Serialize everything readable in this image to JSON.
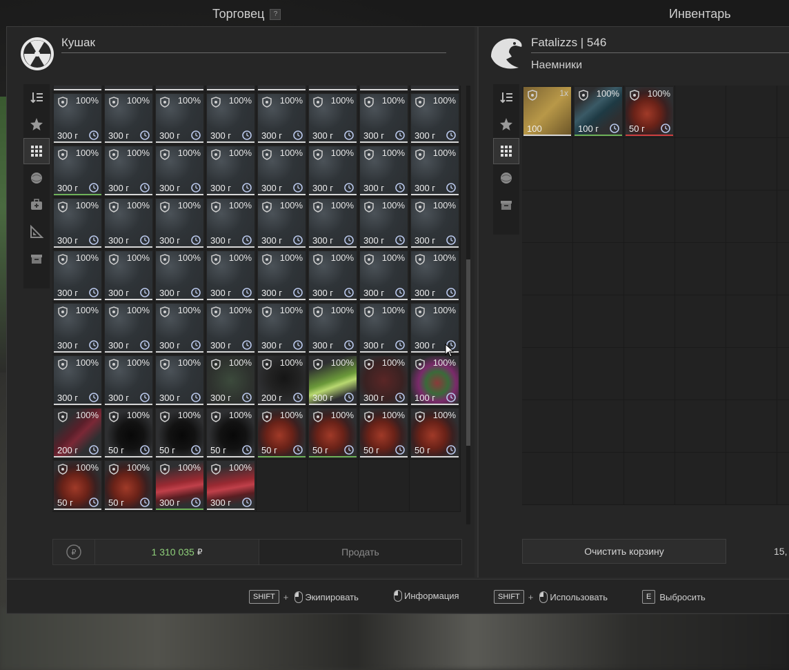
{
  "trader": {
    "title": "Торговец",
    "help": "?",
    "name": "Кушак",
    "money": "1 310 035",
    "currency": "₽",
    "sell_label": "Продать",
    "tabs": [
      "sort-icon",
      "star-icon",
      "grid-icon",
      "artifact-icon",
      "medkit-icon",
      "tools-icon",
      "box-icon"
    ],
    "active_tab": 2
  },
  "inventory": {
    "title": "Инвентарь",
    "player": "Fatalizzs | 546",
    "faction": "Наемники",
    "clear_label": "Очистить корзину",
    "weight": "15,",
    "tabs": [
      "sort-icon",
      "star-icon",
      "grid-icon",
      "artifact-icon",
      "box-icon"
    ],
    "active_tab": 2
  },
  "footer": {
    "shift": "SHIFT",
    "equip": "Экипировать",
    "info": "Информация",
    "use": "Использовать",
    "e_key": "E",
    "drop": "Выбросить"
  },
  "trader_items": [
    [
      "300 г",
      "300 г",
      "300 г",
      "300 г",
      "300 г",
      "300 г",
      "300 г",
      "300 г"
    ],
    [
      "300 г",
      "300 г",
      "300 г",
      "300 г",
      "300 г",
      "300 г",
      "300 г",
      "300 г"
    ],
    [
      "300 г",
      "300 г",
      "300 г",
      "300 г",
      "300 г",
      "300 г",
      "300 г",
      "300 г"
    ],
    [
      "300 г",
      "300 г",
      "300 г",
      "300 г",
      "300 г",
      "300 г",
      "300 г",
      "300 г"
    ],
    [
      "300 г",
      "300 г",
      "300 г",
      "300 г",
      "300 г",
      "300 г",
      "300 г",
      "300 г"
    ],
    [
      "300 г",
      "300 г",
      "300 г",
      "300 г",
      "200 г",
      "300 г",
      "300 г",
      "100 г"
    ],
    [
      "200 г",
      "50 г",
      "50 г",
      "50 г",
      "50 г",
      "50 г",
      "50 г",
      "50 г"
    ],
    [
      "50 г",
      "50 г",
      "300 г",
      "300 г"
    ]
  ],
  "trader_arts": [
    [
      "rock",
      "rock",
      "rock",
      "rock",
      "rock",
      "rock",
      "rock",
      "rock"
    ],
    [
      "rock",
      "rock",
      "rock",
      "rock",
      "rock",
      "rock",
      "rock",
      "rock"
    ],
    [
      "rock",
      "rock",
      "rock",
      "rock",
      "rock",
      "rock",
      "rock",
      "rock"
    ],
    [
      "rock",
      "rock",
      "rock",
      "rock",
      "rock",
      "rock",
      "rock",
      "rock"
    ],
    [
      "rock",
      "rock",
      "rock",
      "rock",
      "rock",
      "rock",
      "rock",
      "rock"
    ],
    [
      "rock",
      "rock",
      "rock",
      "darkgreen",
      "dark",
      "spikes",
      "redball",
      "colorful"
    ],
    [
      "redfeather",
      "black",
      "black",
      "black",
      "meat",
      "meat",
      "meat",
      "meat"
    ],
    [
      "meat",
      "meat",
      "redspikes",
      "redspikes"
    ]
  ],
  "trader_underlines": [
    [
      "",
      "",
      "",
      "",
      "",
      "",
      "",
      ""
    ],
    [
      "green",
      "",
      "",
      "",
      "",
      "",
      "",
      ""
    ],
    [
      "",
      "",
      "",
      "",
      "",
      "",
      "",
      ""
    ],
    [
      "",
      "",
      "",
      "",
      "",
      "",
      "",
      ""
    ],
    [
      "",
      "",
      "",
      "",
      "",
      "",
      "",
      ""
    ],
    [
      "",
      "",
      "",
      "",
      "",
      "",
      "",
      ""
    ],
    [
      "",
      "",
      "",
      "",
      "green",
      "green",
      "",
      ""
    ],
    [
      "",
      "",
      "green",
      ""
    ]
  ],
  "durability": "100%",
  "inventory_items": [
    {
      "price": "100",
      "qty": "1x",
      "art": "book"
    },
    {
      "price": "100 г",
      "dur": "100%",
      "art": "bluefeather",
      "line": "green"
    },
    {
      "price": "50 г",
      "dur": "100%",
      "art": "meat",
      "line": "red"
    }
  ],
  "colors": {
    "money": "#8fd17a",
    "accent_green": "#6fb35a",
    "accent_red": "#d04040"
  }
}
